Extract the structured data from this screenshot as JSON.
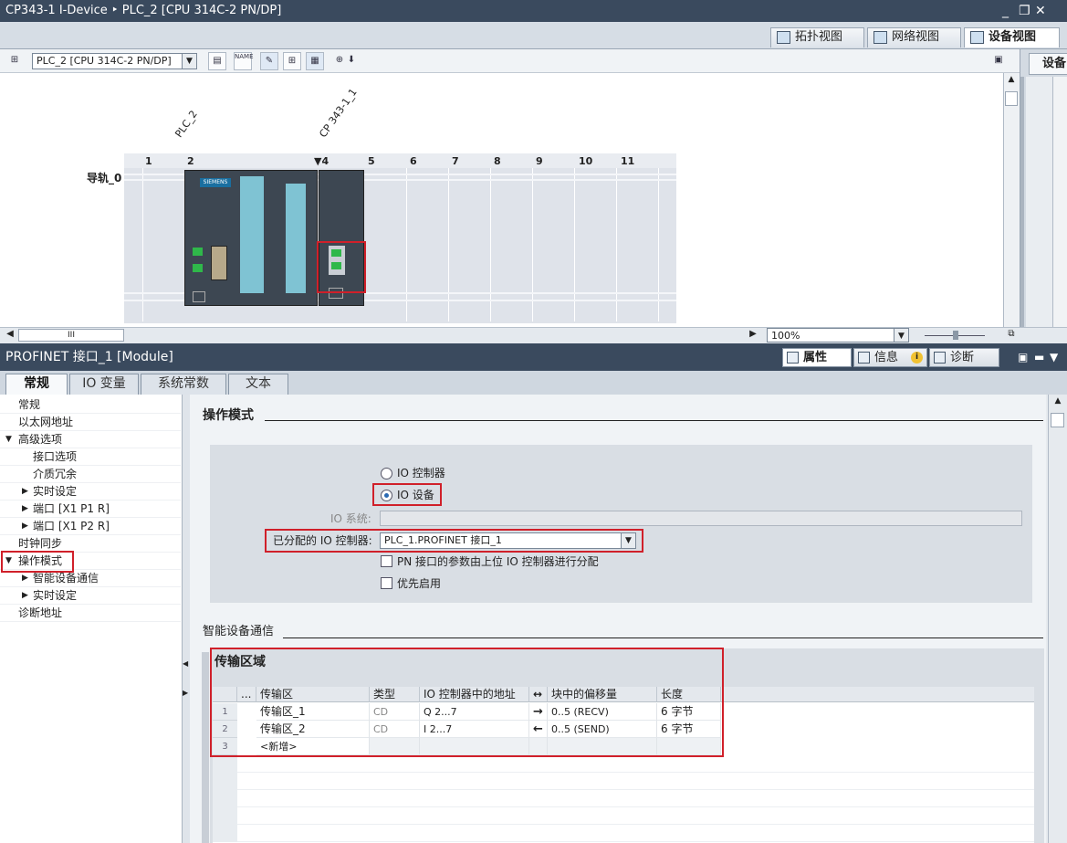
{
  "window": {
    "title": "CP343-1 I-Device ‣ PLC_2 [CPU 314C-2 PN/DP]",
    "controls": [
      "_",
      "❐",
      "✕"
    ]
  },
  "view_tabs": [
    {
      "label": "拓扑视图",
      "icon": "topology-icon"
    },
    {
      "label": "网络视图",
      "icon": "network-icon"
    },
    {
      "label": "设备视图",
      "icon": "device-icon",
      "active": true
    }
  ],
  "right_panel_tab": "设备",
  "toolbar": {
    "device_selector": "PLC_2 [CPU 314C-2 PN/DP]",
    "name_icon_text": "NAME"
  },
  "rack": {
    "rail_label": "导轨_0",
    "module_labels": [
      "PLC_2",
      "CP 343-1_1"
    ],
    "slots": [
      "1",
      "2",
      "4",
      "5",
      "6",
      "7",
      "8",
      "9",
      "10",
      "11"
    ],
    "cpu_brand": "SIEMENS"
  },
  "statusbar": {
    "zoom": "100%",
    "hscroll_grip": "III"
  },
  "inspector": {
    "title": "PROFINET 接口_1 [Module]",
    "right_tabs": [
      {
        "label": "属性",
        "active": true
      },
      {
        "label": "信息"
      },
      {
        "label": "诊断"
      }
    ],
    "info_badge": "i",
    "subtabs": [
      {
        "label": "常规",
        "active": true
      },
      {
        "label": "IO 变量"
      },
      {
        "label": "系统常数"
      },
      {
        "label": "文本"
      }
    ]
  },
  "nav": [
    {
      "label": "常规",
      "level": 0,
      "arrow": ""
    },
    {
      "label": "以太网地址",
      "level": 0,
      "arrow": ""
    },
    {
      "label": "高级选项",
      "level": 0,
      "arrow": "▼"
    },
    {
      "label": "接口选项",
      "level": 2,
      "arrow": ""
    },
    {
      "label": "介质冗余",
      "level": 2,
      "arrow": ""
    },
    {
      "label": "实时设定",
      "level": 1,
      "arrow": "▶"
    },
    {
      "label": "端口 [X1 P1 R]",
      "level": 1,
      "arrow": "▶"
    },
    {
      "label": "端口 [X1 P2 R]",
      "level": 1,
      "arrow": "▶"
    },
    {
      "label": "时钟同步",
      "level": 0,
      "arrow": ""
    },
    {
      "label": "操作模式",
      "level": 0,
      "arrow": "▼"
    },
    {
      "label": "智能设备通信",
      "level": 1,
      "arrow": "▶"
    },
    {
      "label": "实时设定",
      "level": 1,
      "arrow": "▶"
    },
    {
      "label": "诊断地址",
      "level": 0,
      "arrow": ""
    }
  ],
  "operation_mode": {
    "heading": "操作模式",
    "radio_controller": "IO 控制器",
    "radio_device": "IO 设备",
    "selected": "IO 设备",
    "io_system_label": "IO 系统:",
    "io_system_value": "",
    "assigned_controller_label": "已分配的 IO 控制器:",
    "assigned_controller_value": "PLC_1.PROFINET 接口_1",
    "pn_params_label": "PN 接口的参数由上位 IO 控制器进行分配",
    "priority_label": "优先启用"
  },
  "smart_device": {
    "heading": "智能设备通信",
    "transfer_area_title": "传输区域",
    "columns": [
      "...",
      "传输区",
      "类型",
      "IO 控制器中的地址",
      "↔",
      "块中的偏移量",
      "长度"
    ],
    "rows": [
      {
        "num": "1",
        "name": "传输区_1",
        "type": "CD",
        "address": "Q 2...7",
        "dir": "→",
        "offset": "0..5 (RECV)",
        "length": "6 字节"
      },
      {
        "num": "2",
        "name": "传输区_2",
        "type": "CD",
        "address": "I 2...7",
        "dir": "←",
        "offset": "0..5 (SEND)",
        "length": "6 字节"
      },
      {
        "num": "3",
        "name": "<新增>",
        "type": "",
        "address": "",
        "dir": "",
        "offset": "",
        "length": ""
      }
    ]
  }
}
